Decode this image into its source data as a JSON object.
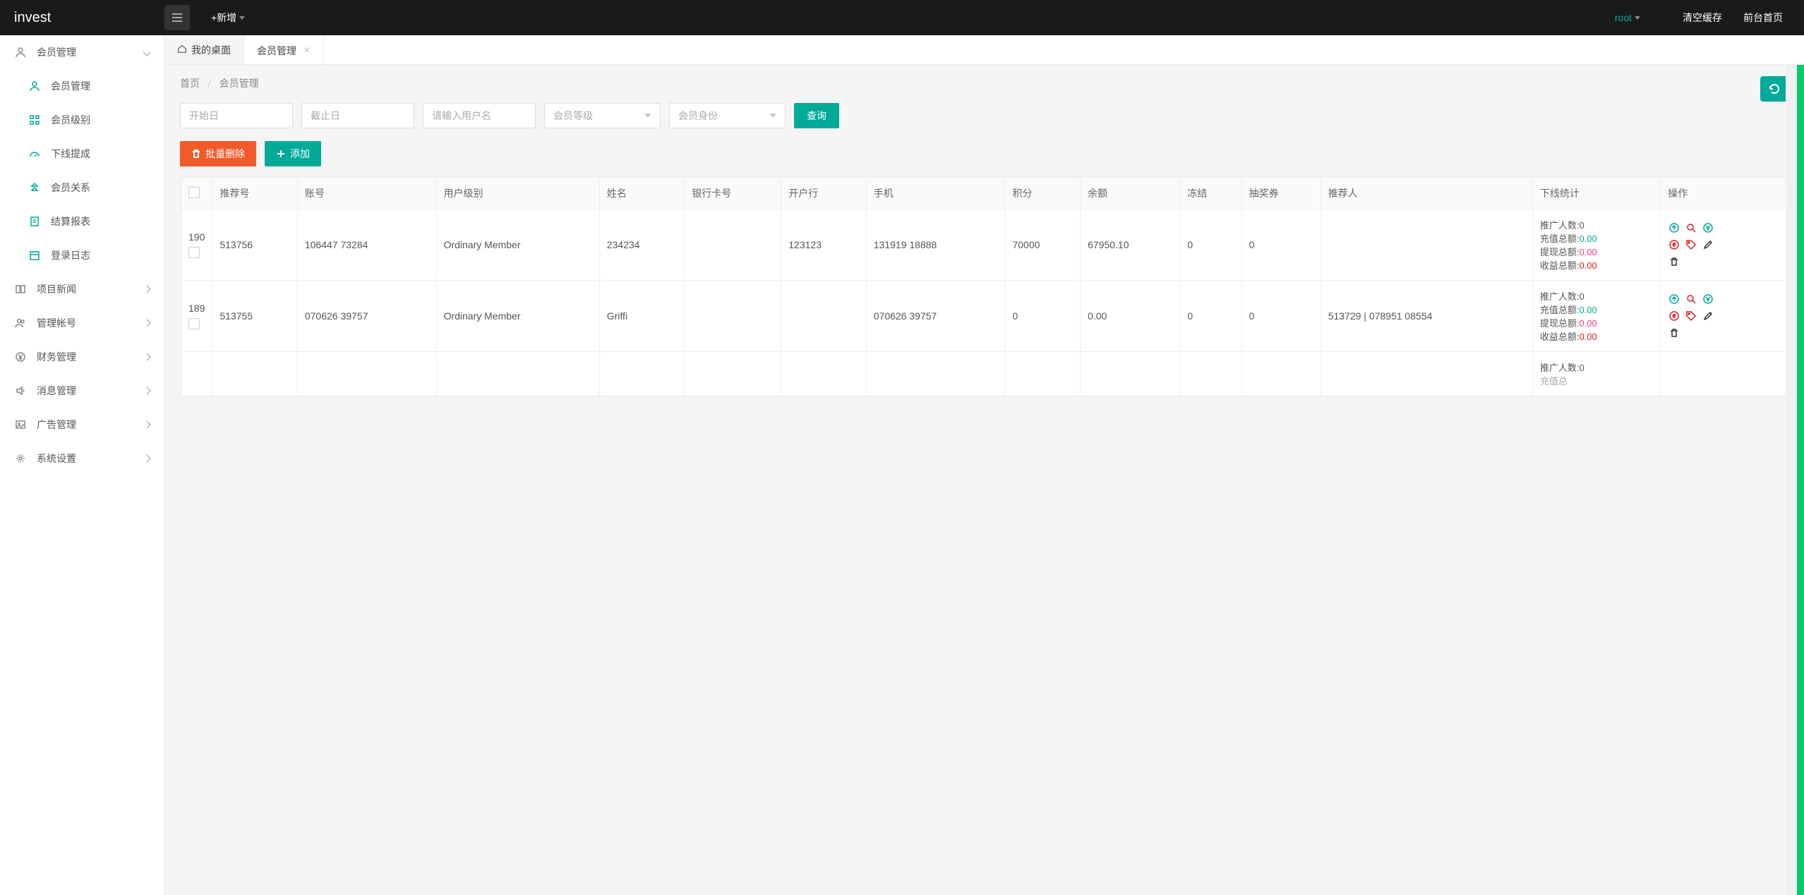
{
  "header": {
    "logo": "invest",
    "new_label": "+新增",
    "user": "root",
    "clear_cache": "清空缓存",
    "front_home": "前台首页"
  },
  "sidebar": {
    "groups": [
      {
        "label": "会员管理",
        "expanded": true,
        "icon": "user"
      },
      {
        "label": "项目新闻",
        "expanded": false,
        "icon": "book"
      },
      {
        "label": "管理帐号",
        "expanded": false,
        "icon": "users"
      },
      {
        "label": "财务管理",
        "expanded": false,
        "icon": "yen"
      },
      {
        "label": "消息管理",
        "expanded": false,
        "icon": "speaker"
      },
      {
        "label": "广告管理",
        "expanded": false,
        "icon": "image"
      },
      {
        "label": "系统设置",
        "expanded": false,
        "icon": "gear"
      }
    ],
    "sub": [
      {
        "label": "会员管理",
        "icon": "user"
      },
      {
        "label": "会员级别",
        "icon": "grid"
      },
      {
        "label": "下线提成",
        "icon": "gauge"
      },
      {
        "label": "会员关系",
        "icon": "tree"
      },
      {
        "label": "结算报表",
        "icon": "report"
      },
      {
        "label": "登录日志",
        "icon": "calendar"
      }
    ]
  },
  "tabs": [
    {
      "label": "我的桌面",
      "closable": false,
      "home": true
    },
    {
      "label": "会员管理",
      "closable": true,
      "active": true
    }
  ],
  "breadcrumb": {
    "home": "首页",
    "current": "会员管理"
  },
  "filters": {
    "start_placeholder": "开始日",
    "end_placeholder": "截止日",
    "username_placeholder": "请输入用户名",
    "level_placeholder": "会员等级",
    "role_placeholder": "会员身份",
    "search": "查询"
  },
  "actions": {
    "batch_delete": "批量删除",
    "add": "添加"
  },
  "table": {
    "columns": [
      "",
      "推荐号",
      "账号",
      "用户级别",
      "姓名",
      "银行卡号",
      "开户行",
      "手机",
      "积分",
      "余额",
      "冻结",
      "抽奖券",
      "推荐人",
      "下线统计",
      "操作"
    ],
    "stat_labels": {
      "promo_count": "推广人数:",
      "recharge": "充值总额:",
      "withdraw": "提现总额:",
      "income": "收益总额:"
    },
    "rows": [
      {
        "id": "190",
        "ref": "513756",
        "account": "106447 73284",
        "level": "Ordinary Member",
        "name": "234234",
        "bankcard": "",
        "bank": "123123",
        "phone": "131919 18888",
        "points": "70000",
        "balance": "67950.10",
        "frozen": "0",
        "lottery": "0",
        "referrer": "",
        "stats": {
          "promo": "0",
          "recharge": "0.00",
          "withdraw": "0.00",
          "income": "0.00"
        }
      },
      {
        "id": "189",
        "ref": "513755",
        "account": "070626 39757",
        "level": "Ordinary Member",
        "name": "Griffi",
        "bankcard": "",
        "bank": "",
        "phone": "070626 39757",
        "points": "0",
        "balance": "0.00",
        "frozen": "0",
        "lottery": "0",
        "referrer": "513729 | 078951 08554",
        "stats": {
          "promo": "0",
          "recharge": "0.00",
          "withdraw": "0.00",
          "income": "0.00"
        }
      }
    ]
  }
}
